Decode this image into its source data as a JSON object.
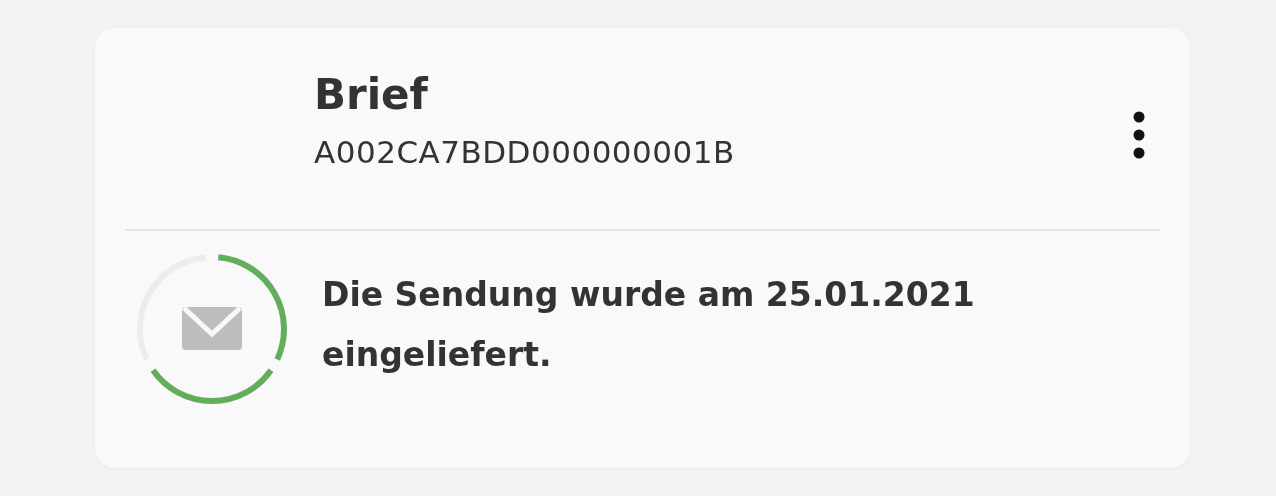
{
  "shipment": {
    "type": "Brief",
    "tracking_number": "A002CA7BDD000000001B"
  },
  "status": {
    "message": "Die Sendung wurde am 25.01.2021 eingeliefert.",
    "steps": [
      {
        "done": true
      },
      {
        "done": true
      },
      {
        "done": false
      }
    ]
  }
}
